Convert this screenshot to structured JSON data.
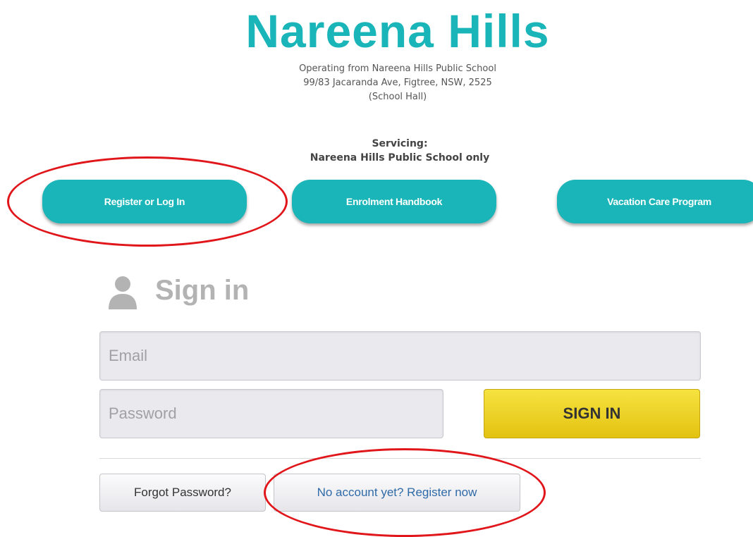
{
  "header": {
    "brand": "Nareena Hills",
    "address_lines": [
      "Operating from Nareena Hills Public School",
      "99/83 Jacaranda Ave, Figtree, NSW, 2525",
      "(School Hall)"
    ],
    "servicing_label": "Servicing:",
    "servicing_value": "Nareena Hills Public School only"
  },
  "nav": {
    "buttons": [
      {
        "label": "Register or Log In"
      },
      {
        "label": "Enrolment Handbook"
      },
      {
        "label": "Vacation Care Program"
      }
    ]
  },
  "signin": {
    "title": "Sign in",
    "icon": "person-icon",
    "email_placeholder": "Email",
    "email_value": "",
    "password_placeholder": "Password",
    "password_value": "",
    "submit_label": "SIGN IN",
    "forgot_label": "Forgot Password?",
    "register_label": "No account yet? Register now"
  },
  "colors": {
    "brand": "#1ab5b8",
    "signin_button": "#eed427",
    "annotation": "#e0161b",
    "link": "#2f6aa8"
  }
}
